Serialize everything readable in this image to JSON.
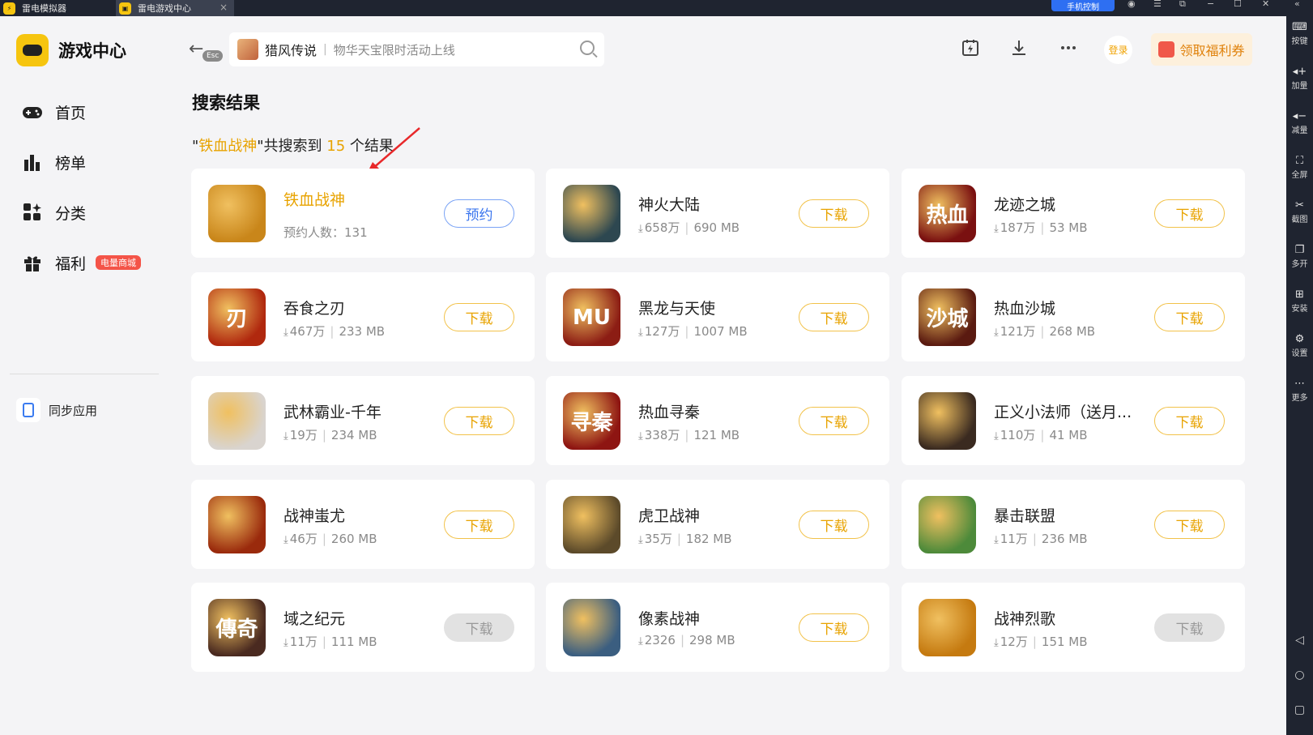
{
  "titlebar": {
    "tab1": "雷电模拟器",
    "tab2": "雷电游戏中心",
    "tab2_close": "×",
    "phone_control": "手机控制"
  },
  "sidebar": {
    "logo_text": "游戏中心",
    "nav": [
      {
        "label": "首页",
        "icon": "gamepad-icon"
      },
      {
        "label": "榜单",
        "icon": "bar-chart-icon"
      },
      {
        "label": "分类",
        "icon": "grid-icon"
      },
      {
        "label": "福利",
        "icon": "gift-icon",
        "badge": "电量商城"
      }
    ],
    "sync_label": "同步应用"
  },
  "topbar": {
    "esc": "Esc",
    "search_game": "猎风传说",
    "search_sep": "|",
    "search_hint": "物华天宝限时活动上线",
    "login": "登录",
    "welfare": "领取福利券",
    "icons": [
      "calendar-icon",
      "download-icon",
      "more-icon"
    ]
  },
  "main": {
    "section_title": "搜索结果",
    "result_prefix": "\"",
    "query": "铁血战神",
    "result_mid": "\"共搜索到 ",
    "count": "15",
    "result_suffix": " 个结果"
  },
  "games": [
    {
      "name": "铁血战神",
      "meta_reserve": "预约人数：131",
      "action": "预约",
      "type": "reserve",
      "icon_color": "#c9861a",
      "icon_char": ""
    },
    {
      "name": "神火大陆",
      "downloads": "658万",
      "size": "690 MB",
      "action": "下载",
      "type": "download",
      "icon_color": "#2d4750",
      "icon_char": ""
    },
    {
      "name": "龙迹之城",
      "downloads": "187万",
      "size": "53 MB",
      "action": "下载",
      "type": "download",
      "icon_color": "#7a1010",
      "icon_char": "热血"
    },
    {
      "name": "吞食之刃",
      "downloads": "467万",
      "size": "233 MB",
      "action": "下载",
      "type": "download",
      "icon_color": "#b0280e",
      "icon_char": "刃"
    },
    {
      "name": "黑龙与天使",
      "downloads": "127万",
      "size": "1007 MB",
      "action": "下载",
      "type": "download",
      "icon_color": "#8c1d14",
      "icon_char": "MU"
    },
    {
      "name": "热血沙城",
      "downloads": "121万",
      "size": "268 MB",
      "action": "下载",
      "type": "download",
      "icon_color": "#5a1a10",
      "icon_char": "沙城"
    },
    {
      "name": "武林霸业-千年",
      "downloads": "19万",
      "size": "234 MB",
      "action": "下载",
      "type": "download",
      "icon_color": "#d9d4cf",
      "icon_char": ""
    },
    {
      "name": "热血寻秦",
      "downloads": "338万",
      "size": "121 MB",
      "action": "下载",
      "type": "download",
      "icon_color": "#8e1512",
      "icon_char": "寻秦"
    },
    {
      "name": "正义小法师（送月...",
      "downloads": "110万",
      "size": "41 MB",
      "action": "下载",
      "type": "download",
      "icon_color": "#3a2a20",
      "icon_char": ""
    },
    {
      "name": "战神蚩尤",
      "downloads": "46万",
      "size": "260 MB",
      "action": "下载",
      "type": "download",
      "icon_color": "#9a2a0c",
      "icon_char": ""
    },
    {
      "name": "虎卫战神",
      "downloads": "35万",
      "size": "182 MB",
      "action": "下载",
      "type": "download",
      "icon_color": "#5c4a2a",
      "icon_char": ""
    },
    {
      "name": "暴击联盟",
      "downloads": "11万",
      "size": "236 MB",
      "action": "下载",
      "type": "download",
      "icon_color": "#4d8a3a",
      "icon_char": ""
    },
    {
      "name": "域之纪元",
      "downloads": "11万",
      "size": "111 MB",
      "action": "下载",
      "type": "disabled",
      "icon_color": "#4a2a20",
      "icon_char": "傳奇"
    },
    {
      "name": "像素战神",
      "downloads": "2326",
      "size": "298 MB",
      "action": "下载",
      "type": "download",
      "icon_color": "#3b5e80",
      "icon_char": ""
    },
    {
      "name": "战神烈歌",
      "downloads": "12万",
      "size": "151 MB",
      "action": "下载",
      "type": "disabled",
      "icon_color": "#c57a10",
      "icon_char": ""
    }
  ],
  "rightbar": [
    {
      "label": "按键",
      "icon": "keyboard-icon"
    },
    {
      "label": "加量",
      "icon": "volume-up-icon"
    },
    {
      "label": "减量",
      "icon": "volume-down-icon"
    },
    {
      "label": "全屏",
      "icon": "fullscreen-icon"
    },
    {
      "label": "截图",
      "icon": "scissors-icon"
    },
    {
      "label": "多开",
      "icon": "multi-window-icon"
    },
    {
      "label": "安装",
      "icon": "install-icon"
    },
    {
      "label": "设置",
      "icon": "settings-icon"
    },
    {
      "label": "更多",
      "icon": "more-icon"
    }
  ]
}
